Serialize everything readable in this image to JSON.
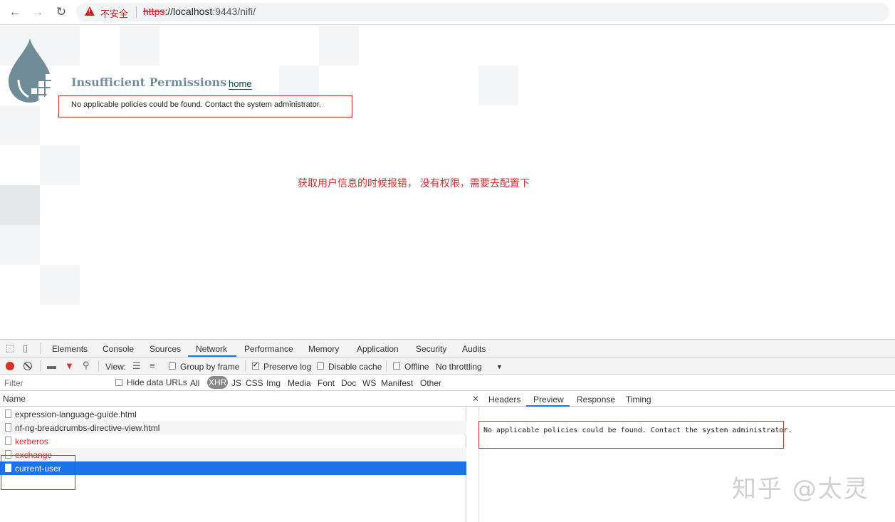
{
  "browser": {
    "security_label": "不安全",
    "url_scheme": "https",
    "url_rest": "://localhost",
    "url_port_path": ":9443/nifi/"
  },
  "page": {
    "title": "Insufficient Permissions",
    "home_link": "home",
    "message": "No applicable policies could be found. Contact the system administrator.",
    "annotation": "获取用户信息的时候报错， 没有权限，需要去配置下"
  },
  "devtools": {
    "tabs": [
      "Elements",
      "Console",
      "Sources",
      "Network",
      "Performance",
      "Memory",
      "Application",
      "Security",
      "Audits"
    ],
    "active_tab": "Network",
    "toolbar": {
      "view_label": "View:",
      "group_by_frame": "Group by frame",
      "preserve_log": "Preserve log",
      "disable_cache": "Disable cache",
      "offline": "Offline",
      "throttling": "No throttling"
    },
    "filter": {
      "placeholder": "Filter",
      "hide_data_urls": "Hide data URLs",
      "types": [
        "All",
        "XHR",
        "JS",
        "CSS",
        "Img",
        "Media",
        "Font",
        "Doc",
        "WS",
        "Manifest",
        "Other"
      ],
      "active_type": "XHR"
    },
    "requests": {
      "column_name": "Name",
      "rows": [
        {
          "name": "expression-language-guide.html",
          "status": "ok"
        },
        {
          "name": "nf-ng-breadcrumbs-directive-view.html",
          "status": "ok"
        },
        {
          "name": "kerberos",
          "status": "error"
        },
        {
          "name": "exchange",
          "status": "error"
        },
        {
          "name": "current-user",
          "status": "selected"
        }
      ]
    },
    "detail": {
      "tabs": [
        "Headers",
        "Preview",
        "Response",
        "Timing"
      ],
      "active_tab": "Preview",
      "preview_text": "No applicable policies could be found. Contact the system administrator."
    }
  },
  "watermark": "知乎 @太灵",
  "colors": {
    "accent": "#1a73e8",
    "error": "#d32f2f",
    "nifi_title": "#728e9b"
  }
}
